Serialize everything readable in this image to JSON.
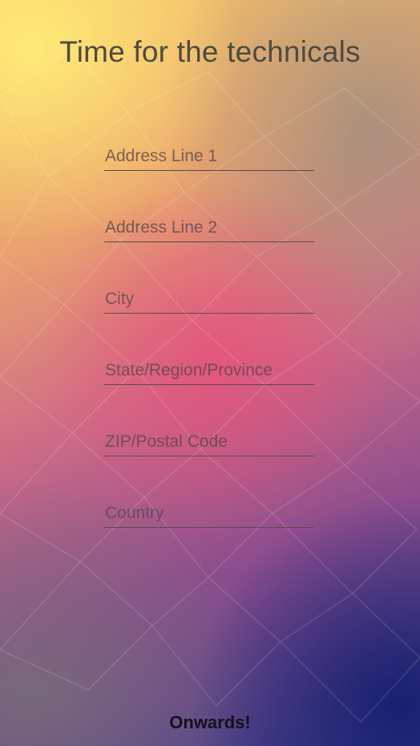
{
  "title": "Time for the technicals",
  "fields": [
    {
      "placeholder": "Address Line 1",
      "value": ""
    },
    {
      "placeholder": "Address Line 2",
      "value": ""
    },
    {
      "placeholder": "City",
      "value": ""
    },
    {
      "placeholder": "State/Region/Province",
      "value": ""
    },
    {
      "placeholder": "ZIP/Postal Code",
      "value": ""
    },
    {
      "placeholder": "Country",
      "value": ""
    }
  ],
  "submit_label": "Onwards!"
}
